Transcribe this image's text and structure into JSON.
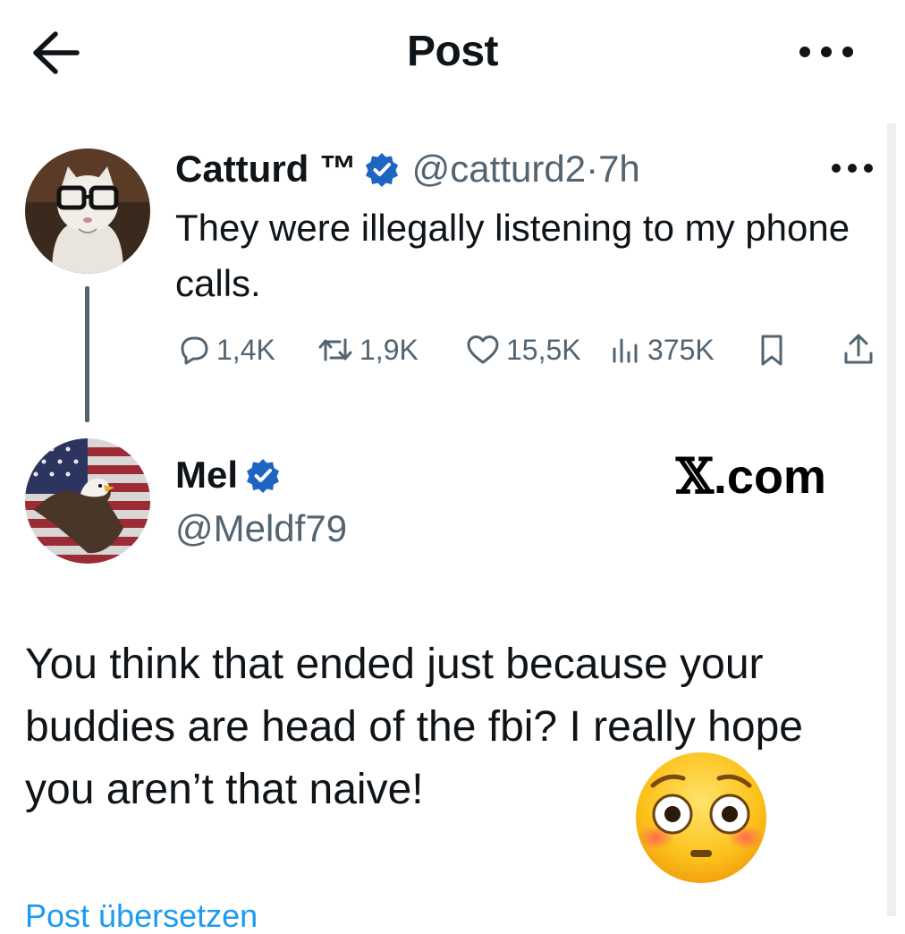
{
  "header": {
    "title": "Post",
    "back_icon": "arrow-left-icon",
    "more_icon": "ellipsis-icon"
  },
  "original_tweet": {
    "display_name": "Catturd ™",
    "verified": true,
    "handle": "@catturd2",
    "separator": "·",
    "time": "7h",
    "text": "They were illegally listening to my phone calls.",
    "actions": {
      "replies": "1,4K",
      "reposts": "1,9K",
      "likes": "15,5K",
      "views": "375K"
    }
  },
  "reply": {
    "display_name": "Mel",
    "verified": true,
    "handle": "@Meldf79",
    "text": "You think that ended just because your buddies are head of the fbi? I really hope you aren’t that naive!",
    "translate_link": "Post übersetzen"
  },
  "watermark": {
    "x_glyph": "𝕏",
    "text": ".com"
  },
  "colors": {
    "text": "#0f1419",
    "secondary": "#536471",
    "verified_blue": "#1d65c1",
    "link": "#1d9bf0"
  }
}
